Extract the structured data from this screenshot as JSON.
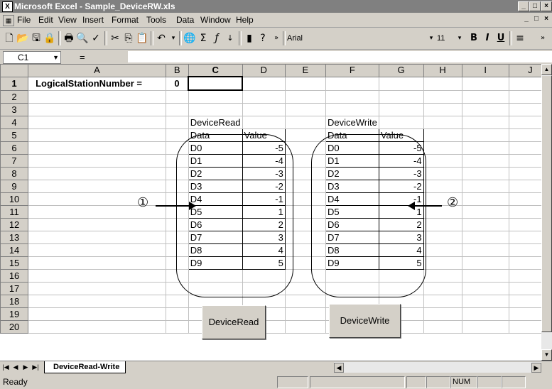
{
  "window": {
    "title": "Microsoft Excel - Sample_DeviceRW.xls",
    "minimize": "_",
    "maximize": "□",
    "close": "×",
    "logo_icon": "excel-icon"
  },
  "menubar": {
    "items": [
      "File",
      "Edit",
      "View",
      "Insert",
      "Format",
      "Tools",
      "Data",
      "Window",
      "Help"
    ]
  },
  "toolbar": {
    "font_name": "Arial",
    "font_size": "11",
    "bold": "B",
    "italic": "I",
    "underline": "U"
  },
  "formula": {
    "name_box": "C1",
    "equals": "="
  },
  "grid": {
    "columns": [
      "A",
      "B",
      "C",
      "D",
      "E",
      "F",
      "G",
      "H",
      "I",
      "J"
    ],
    "rows": [
      "1",
      "2",
      "3",
      "4",
      "5",
      "6",
      "7",
      "8",
      "9",
      "10",
      "11",
      "12",
      "13",
      "14",
      "15",
      "16",
      "17",
      "18",
      "19",
      "20"
    ],
    "a1": "LogicalStationNumber =",
    "b1": "0",
    "read_title": "DeviceRead",
    "write_title": "DeviceWrite",
    "hdr_data": "Data",
    "hdr_value": "Value",
    "devices": [
      "D0",
      "D1",
      "D2",
      "D3",
      "D4",
      "D5",
      "D6",
      "D7",
      "D8",
      "D9"
    ],
    "values": [
      "-5",
      "-4",
      "-3",
      "-2",
      "-1",
      "1",
      "2",
      "3",
      "4",
      "5"
    ]
  },
  "annotations": {
    "left": "①",
    "right": "②"
  },
  "buttons": {
    "read": "DeviceRead",
    "write": "DeviceWrite"
  },
  "sheet_tab": "DeviceRead-Write",
  "status": {
    "ready": "Ready",
    "num": "NUM"
  }
}
